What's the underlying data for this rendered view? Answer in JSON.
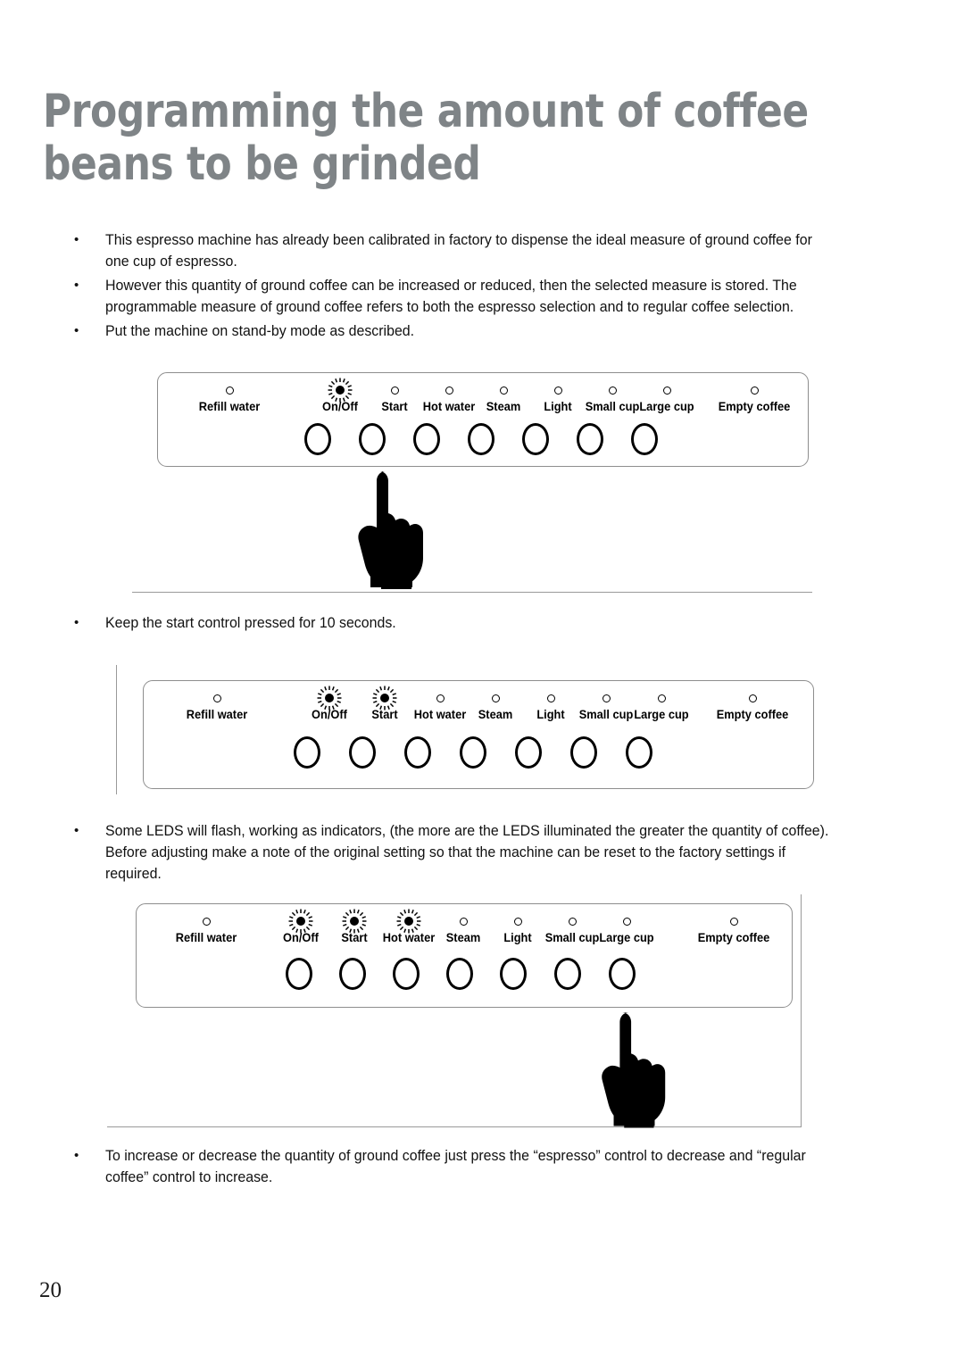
{
  "document": {
    "title": "Programming the amount of coffee beans to be grinded",
    "page_number": "20"
  },
  "bullet_char": "•",
  "intro_bullets": [
    "This espresso machine has already been calibrated in factory to dispense the ideal measure of ground coffee for one cup of espresso.",
    "However this quantity of ground coffee can be increased or reduced, then the selected measure is stored. The programmable measure of ground coffee refers to both the espresso selection and to regular coffee selection.",
    "Put the machine on stand-by mode as described."
  ],
  "bullets_2": [
    "Keep the start control pressed for 10 seconds."
  ],
  "bullets_3": [
    "Some LEDS will flash, working as indicators, (the more are the LEDS illuminated the greater the quantity of coffee). Before adjusting make a note of the original setting so that the machine can be reset to the factory settings if required."
  ],
  "bullets_4": [
    "To increase or decrease the quantity of ground coffee just press the “espresso” control to decrease and “regular coffee” control to increase."
  ],
  "panel_labels": {
    "refill_water": "Refill water",
    "on_off": "On/Off",
    "start": "Start",
    "hot_water": "Hot water",
    "steam": "Steam",
    "light": "Light",
    "small_cup": "Small cup",
    "large_cup": "Large cup",
    "empty_coffee": "Empty coffee"
  },
  "figures": [
    {
      "name": "control-panel-standby",
      "leds_on": [
        "On/Off"
      ],
      "leds_off": [
        "Refill water",
        "Start",
        "Hot water",
        "Steam",
        "Light",
        "Small cup",
        "Large cup",
        "Empty coffee"
      ],
      "button_count": 7,
      "hand_target": "Start"
    },
    {
      "name": "control-panel-start-held",
      "leds_on": [
        "On/Off",
        "Start"
      ],
      "leds_off": [
        "Refill water",
        "Hot water",
        "Steam",
        "Light",
        "Small cup",
        "Large cup",
        "Empty coffee"
      ],
      "button_count": 7,
      "hand_target": null
    },
    {
      "name": "control-panel-leds-flashing",
      "leds_on": [
        "On/Off",
        "Start",
        "Hot water"
      ],
      "leds_off": [
        "Refill water",
        "Steam",
        "Light",
        "Small cup",
        "Large cup",
        "Empty coffee"
      ],
      "button_count": 7,
      "hand_target": "Large cup"
    }
  ],
  "colors": {
    "title": "#7f8487",
    "frame_line": "#9a9a9a",
    "panel_border": "#8e8e8e",
    "led_on": "#000000",
    "body_text": "#111111"
  }
}
